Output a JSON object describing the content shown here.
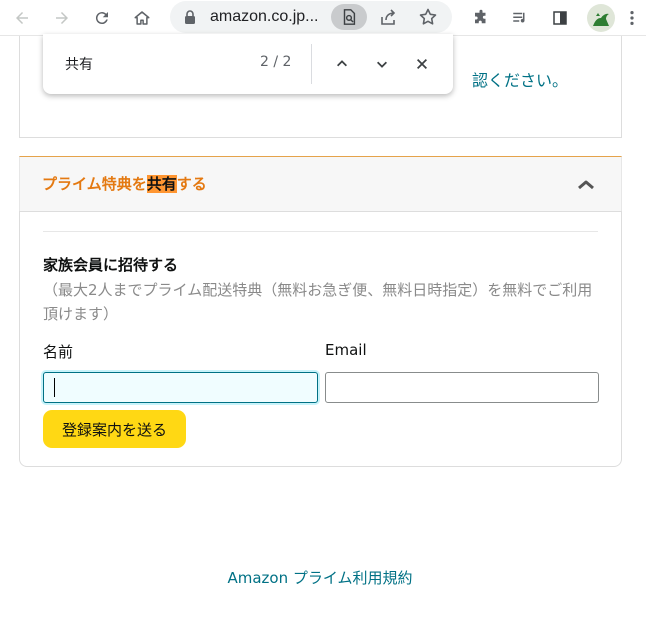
{
  "browser": {
    "url": "amazon.co.jp..."
  },
  "find_bar": {
    "query": "共有",
    "count": "2 / 2"
  },
  "top_card": {
    "partial_text": "認ください。"
  },
  "prime_sharing": {
    "title_before": "プライム特典を",
    "title_highlight": "共有",
    "title_after": "する",
    "invite_title": "家族会員に招待する",
    "invite_description": "（最大2人までプライム配送特典（無料お急ぎ便、無料日時指定）を無料でご利用頂けます）",
    "name_label": "名前",
    "name_value": "",
    "email_label": "Email",
    "email_value": "",
    "send_button": "登録案内を送る"
  },
  "footer": {
    "link": "Amazon プライム利用規約"
  },
  "colors": {
    "link": "#007185",
    "section_title": "#e47911",
    "highlight": "#ff9632",
    "button": "#ffd814"
  }
}
